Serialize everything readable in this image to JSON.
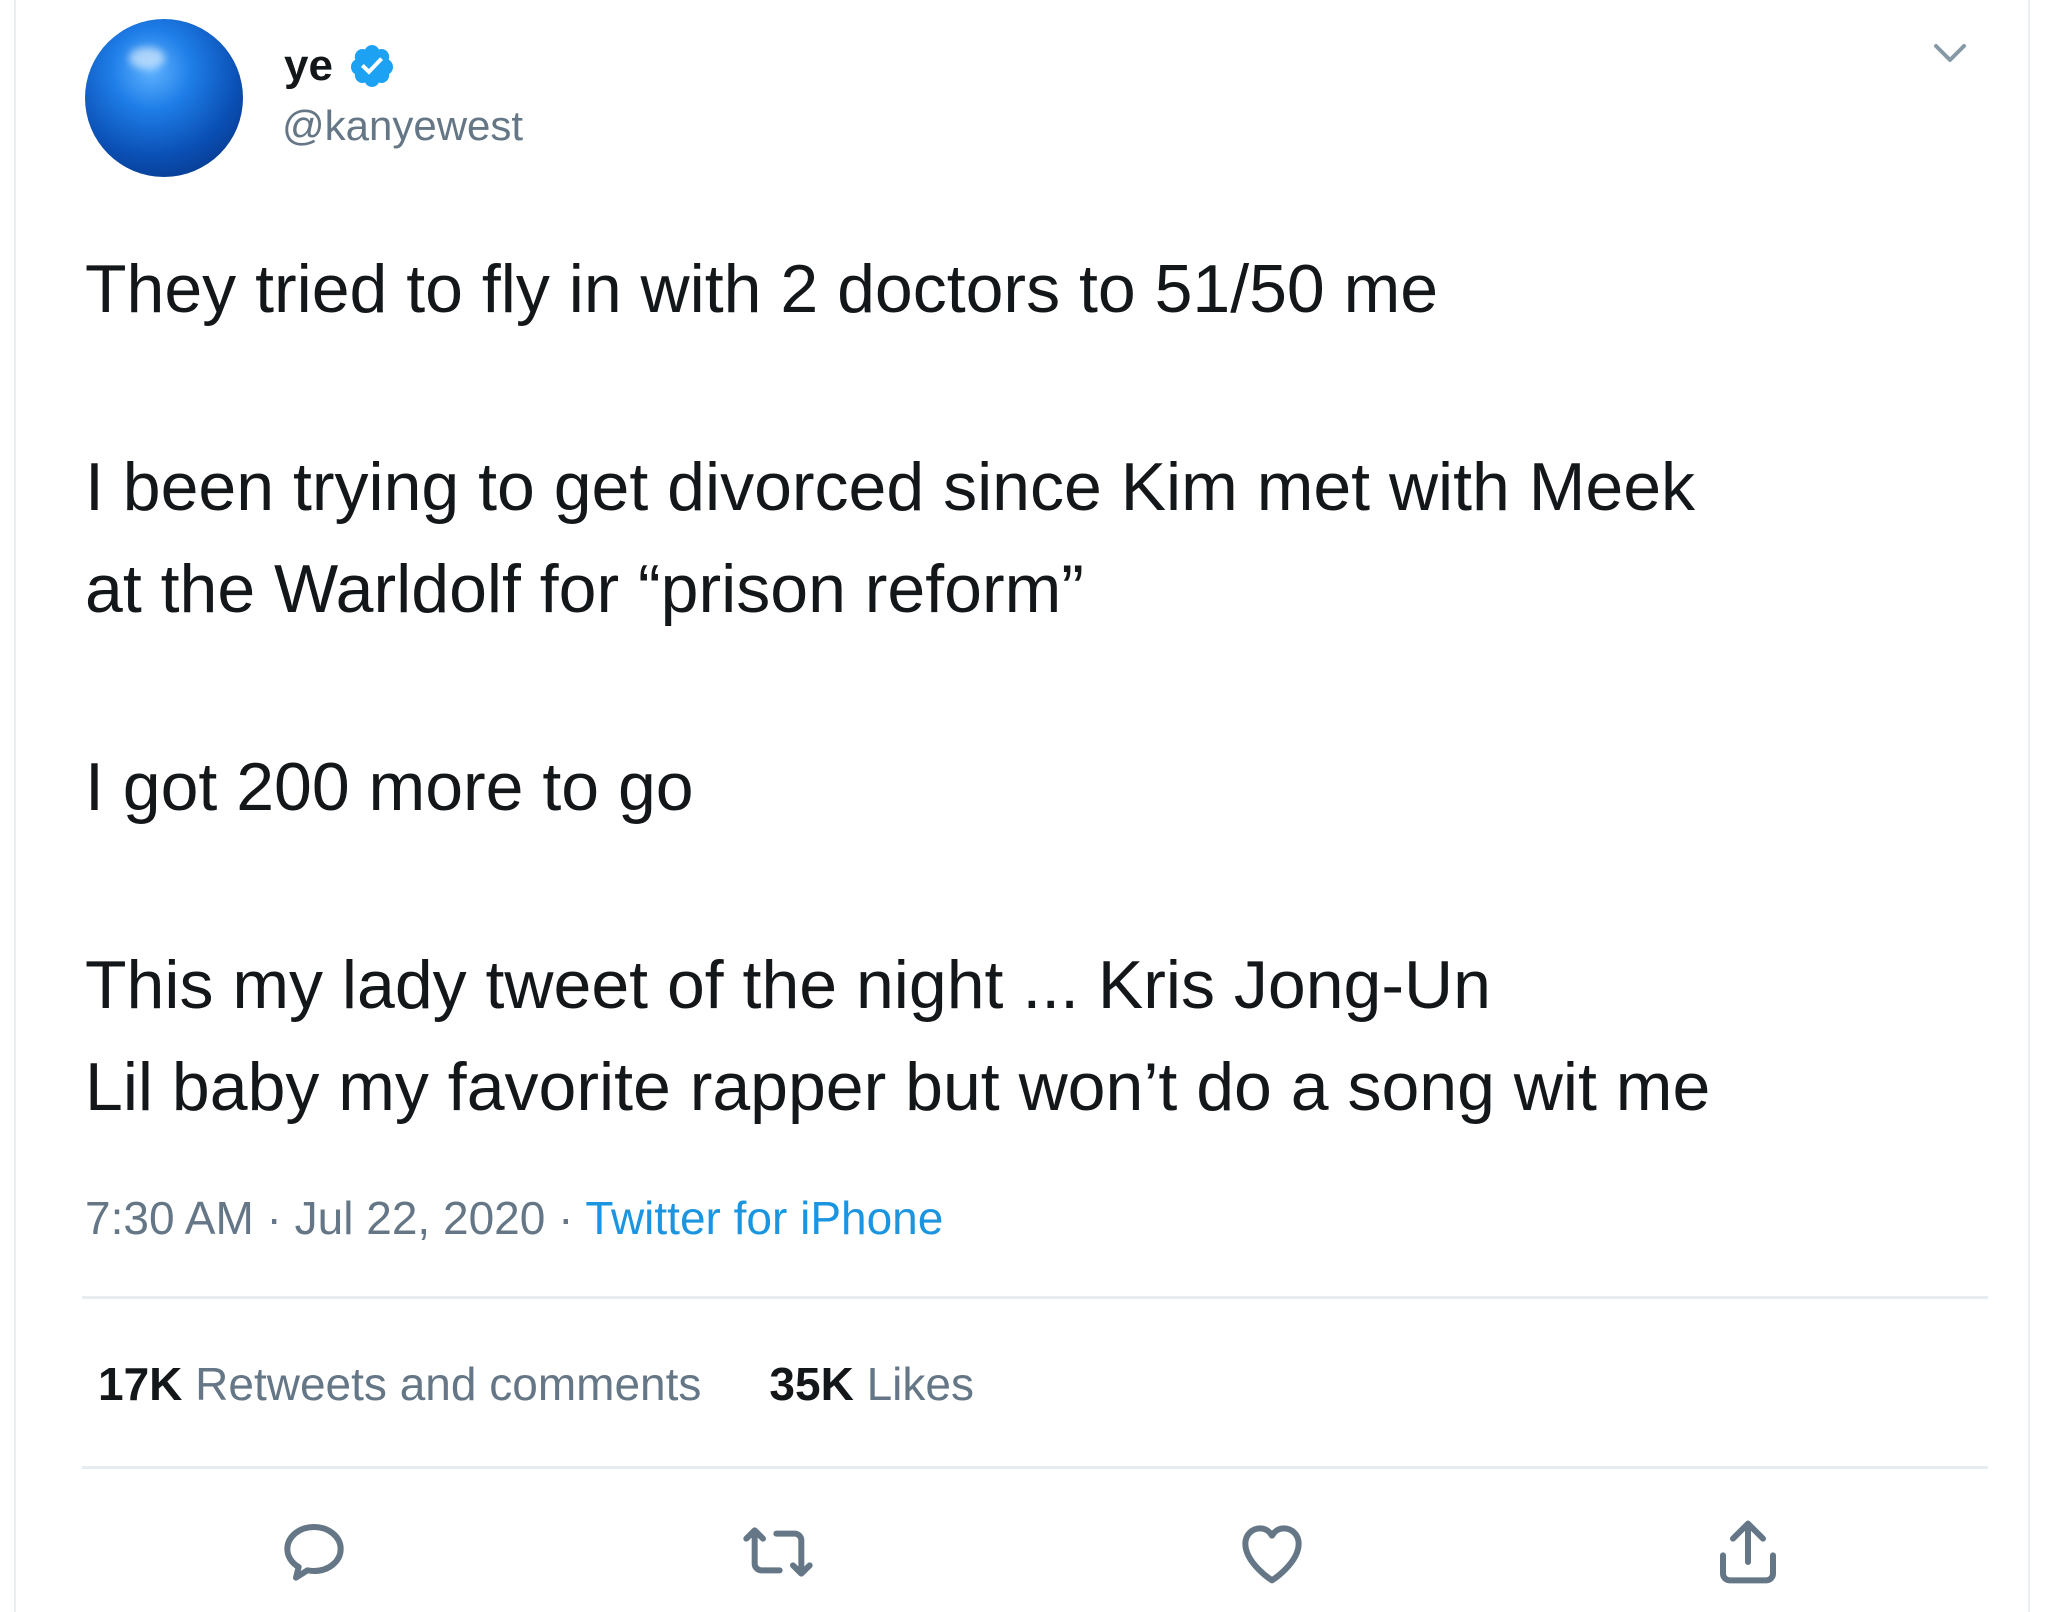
{
  "author": {
    "display_name": "ye",
    "handle": "@kanyewest",
    "verified": true,
    "avatar_icon": "blue-globe-avatar"
  },
  "tweet": {
    "paragraphs": [
      "They tried to fly in with 2 doctors to 51/50 me",
      "I been trying to get divorced since Kim met with Meek",
      "at the Warldolf for “prison reform”",
      "I got 200 more to go",
      "This my lady tweet of the night ... Kris Jong-Un",
      "Lil baby my favorite rapper but won’t do a song wit me"
    ]
  },
  "meta": {
    "time": "7:30 AM",
    "separator": " · ",
    "date": "Jul 22, 2020",
    "source": "Twitter for iPhone"
  },
  "stats": {
    "retweets_count": "17K",
    "retweets_label": " Retweets and comments",
    "likes_count": "35K",
    "likes_label": " Likes"
  },
  "actions": {
    "icons": [
      "reply-icon",
      "retweet-icon",
      "like-icon",
      "share-icon"
    ]
  },
  "colors": {
    "text": "#14171a",
    "secondary": "#657786",
    "link": "#1b95e0",
    "verified": "#1da1f2",
    "divider": "#e6ecf0"
  }
}
